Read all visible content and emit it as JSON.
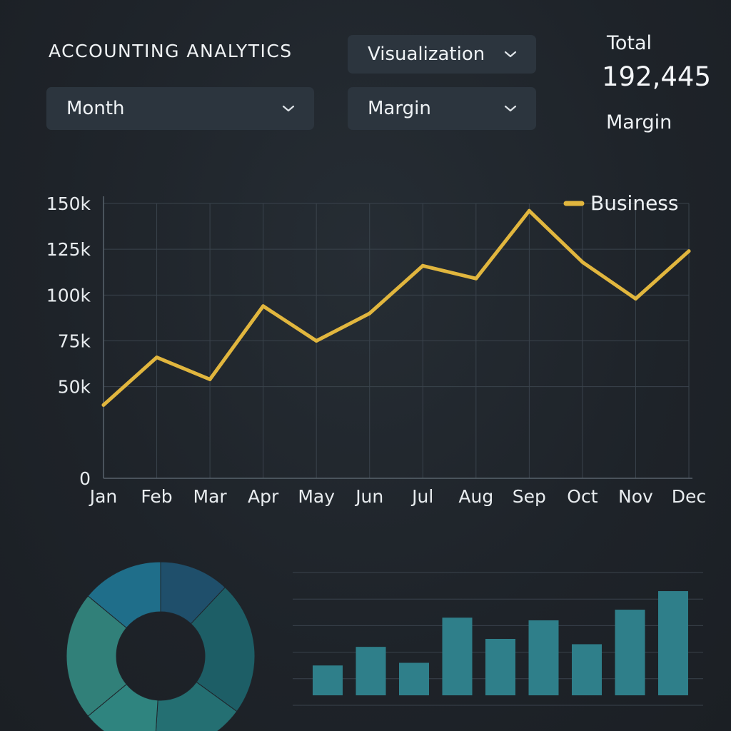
{
  "header": {
    "title": "ACCOUNTING ANALYTICS",
    "visualization_dropdown": "Visualization",
    "period_dropdown": "Month",
    "metric_dropdown": "Margin"
  },
  "kpi": {
    "caption": "Total",
    "value": "192,445",
    "metric": "Margin"
  },
  "colors": {
    "background": "#1f252b",
    "line": "#e1b63e",
    "bars": "#2f7f8a"
  },
  "chart_data": [
    {
      "type": "line",
      "categories": [
        "Jan",
        "Feb",
        "Mar",
        "Apr",
        "May",
        "Jun",
        "Jul",
        "Aug",
        "Sep",
        "Oct",
        "Nov",
        "Dec"
      ],
      "series": [
        {
          "name": "Business",
          "values": [
            40000,
            66000,
            54000,
            94000,
            75000,
            90000,
            116000,
            109000,
            146000,
            118000,
            98000,
            124000
          ]
        }
      ],
      "y_ticks": [
        "0",
        "50k",
        "75k",
        "100k",
        "125k",
        "150k"
      ],
      "ylim": [
        0,
        150000
      ],
      "grid": true,
      "legend": "top-right"
    },
    {
      "type": "pie",
      "donut": true,
      "values": [
        12,
        23,
        16,
        13,
        22,
        14
      ],
      "colors": [
        "#1f4f6b",
        "#1d5e66",
        "#246f72",
        "#2f847f",
        "#318079",
        "#1f6e8a"
      ]
    },
    {
      "type": "bar",
      "values": [
        15,
        22,
        16,
        33,
        25,
        32,
        23,
        36,
        43
      ],
      "ylim": [
        0,
        50
      ],
      "grid": true
    }
  ]
}
